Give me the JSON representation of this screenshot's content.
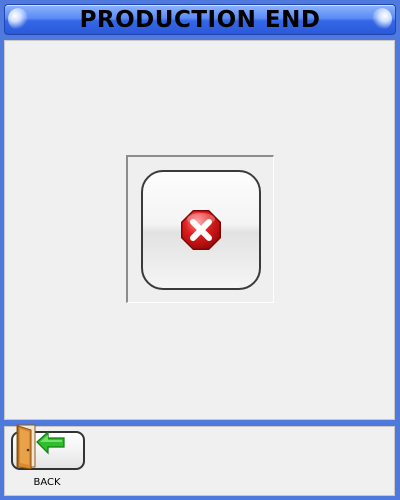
{
  "header": {
    "title": "PRODUCTION END"
  },
  "dialog": {
    "cancel_icon": "red-octagon-x-icon"
  },
  "footer": {
    "back_label": "BACK",
    "back_icon": "door-exit-arrow-icon"
  },
  "colors": {
    "window_background": "#4f79dc",
    "title_bar": "#3567e6",
    "panel": "#f0f0f0",
    "cancel_icon_red": "#d21818",
    "back_arrow_green": "#2fbf2a",
    "door_orange": "#d98a2e"
  }
}
